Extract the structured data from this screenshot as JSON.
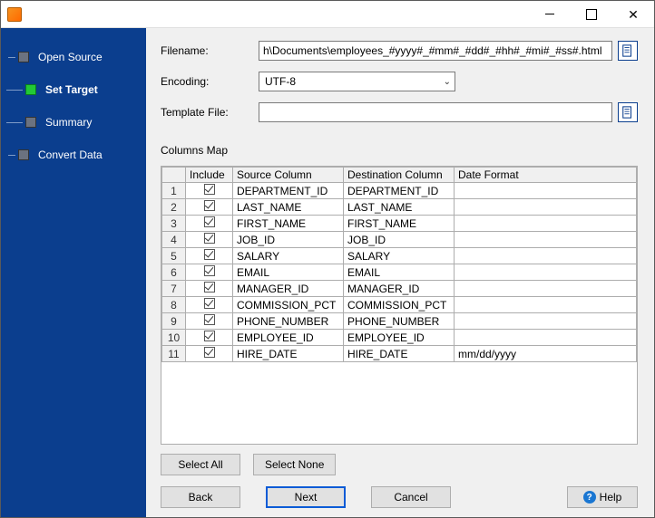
{
  "sidebar": {
    "steps": [
      {
        "label": "Open Source"
      },
      {
        "label": "Set Target"
      },
      {
        "label": "Summary"
      },
      {
        "label": "Convert Data"
      }
    ],
    "active_index": 1
  },
  "form": {
    "filename_label": "Filename:",
    "filename_value": "h\\Documents\\employees_#yyyy#_#mm#_#dd#_#hh#_#mi#_#ss#.html",
    "encoding_label": "Encoding:",
    "encoding_value": "UTF-8",
    "template_label": "Template File:",
    "template_value": ""
  },
  "columns_map": {
    "title": "Columns Map",
    "headers": {
      "include": "Include",
      "source": "Source Column",
      "dest": "Destination Column",
      "fmt": "Date Format"
    },
    "rows": [
      {
        "n": "1",
        "inc": true,
        "src": "DEPARTMENT_ID",
        "dst": "DEPARTMENT_ID",
        "fmt": ""
      },
      {
        "n": "2",
        "inc": true,
        "src": "LAST_NAME",
        "dst": "LAST_NAME",
        "fmt": ""
      },
      {
        "n": "3",
        "inc": true,
        "src": "FIRST_NAME",
        "dst": "FIRST_NAME",
        "fmt": ""
      },
      {
        "n": "4",
        "inc": true,
        "src": "JOB_ID",
        "dst": "JOB_ID",
        "fmt": ""
      },
      {
        "n": "5",
        "inc": true,
        "src": "SALARY",
        "dst": "SALARY",
        "fmt": ""
      },
      {
        "n": "6",
        "inc": true,
        "src": "EMAIL",
        "dst": "EMAIL",
        "fmt": ""
      },
      {
        "n": "7",
        "inc": true,
        "src": "MANAGER_ID",
        "dst": "MANAGER_ID",
        "fmt": ""
      },
      {
        "n": "8",
        "inc": true,
        "src": "COMMISSION_PCT",
        "dst": "COMMISSION_PCT",
        "fmt": ""
      },
      {
        "n": "9",
        "inc": true,
        "src": "PHONE_NUMBER",
        "dst": "PHONE_NUMBER",
        "fmt": ""
      },
      {
        "n": "10",
        "inc": true,
        "src": "EMPLOYEE_ID",
        "dst": "EMPLOYEE_ID",
        "fmt": ""
      },
      {
        "n": "11",
        "inc": true,
        "src": "HIRE_DATE",
        "dst": "HIRE_DATE",
        "fmt": "mm/dd/yyyy"
      }
    ]
  },
  "buttons": {
    "select_all": "Select All",
    "select_none": "Select None",
    "back": "Back",
    "next": "Next",
    "cancel": "Cancel",
    "help": "Help"
  }
}
